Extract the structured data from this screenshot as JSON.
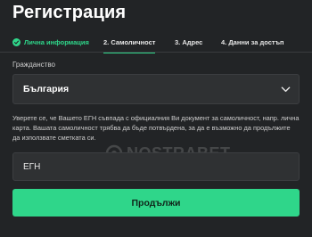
{
  "page": {
    "title": "Регистрация"
  },
  "steps": [
    {
      "label": "Лична информация",
      "state": "done"
    },
    {
      "label": "2. Самоличност",
      "state": "active"
    },
    {
      "label": "3. Адрес",
      "state": "pending"
    },
    {
      "label": "4. Данни за достъп",
      "state": "pending"
    }
  ],
  "citizenship": {
    "label": "Гражданство",
    "selected": "България"
  },
  "notice": "Уверете се, че Вашето ЕГН съвпада с официалния Ви документ за самоличност, напр. лична карта. Вашата самоличност трябва да бъде потвърдена, за да е възможно да продължите да използвате сметката си.",
  "egn": {
    "placeholder": "ЕГН",
    "value": ""
  },
  "submit_label": "Продължи",
  "watermark": "NOSTRABET",
  "colors": {
    "accent": "#2fd68a",
    "background": "#222426",
    "field": "#2f3133"
  },
  "icons": {
    "step_done": "check-circle-icon",
    "select": "chevron-down-icon"
  }
}
